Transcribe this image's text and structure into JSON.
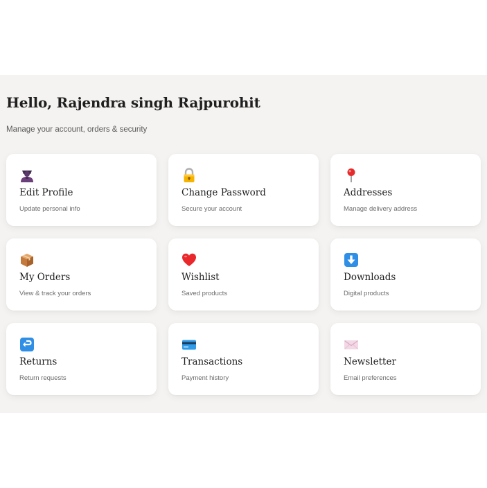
{
  "header": {
    "greeting": "Hello, Rajendra singh Rajpurohit",
    "subtitle": "Manage your account, orders & security"
  },
  "cards": [
    {
      "title": "Edit Profile",
      "desc": "Update personal info",
      "icon": "user-silhouette-icon"
    },
    {
      "title": "Change Password",
      "desc": "Secure your account",
      "icon": "lock-icon"
    },
    {
      "title": "Addresses",
      "desc": "Manage delivery address",
      "icon": "map-pin-icon"
    },
    {
      "title": "My Orders",
      "desc": "View & track your orders",
      "icon": "package-icon"
    },
    {
      "title": "Wishlist",
      "desc": "Saved products",
      "icon": "heart-icon"
    },
    {
      "title": "Downloads",
      "desc": "Digital products",
      "icon": "download-arrow-icon"
    },
    {
      "title": "Returns",
      "desc": "Return requests",
      "icon": "return-arrow-icon"
    },
    {
      "title": "Transactions",
      "desc": "Payment history",
      "icon": "credit-card-icon"
    },
    {
      "title": "Newsletter",
      "desc": "Email preferences",
      "icon": "envelope-icon"
    }
  ],
  "colors": {
    "panel_background": "#f4f3f1",
    "card_background": "#ffffff",
    "title_text": "#1f1f1f",
    "muted_text": "#6b6b6b"
  }
}
